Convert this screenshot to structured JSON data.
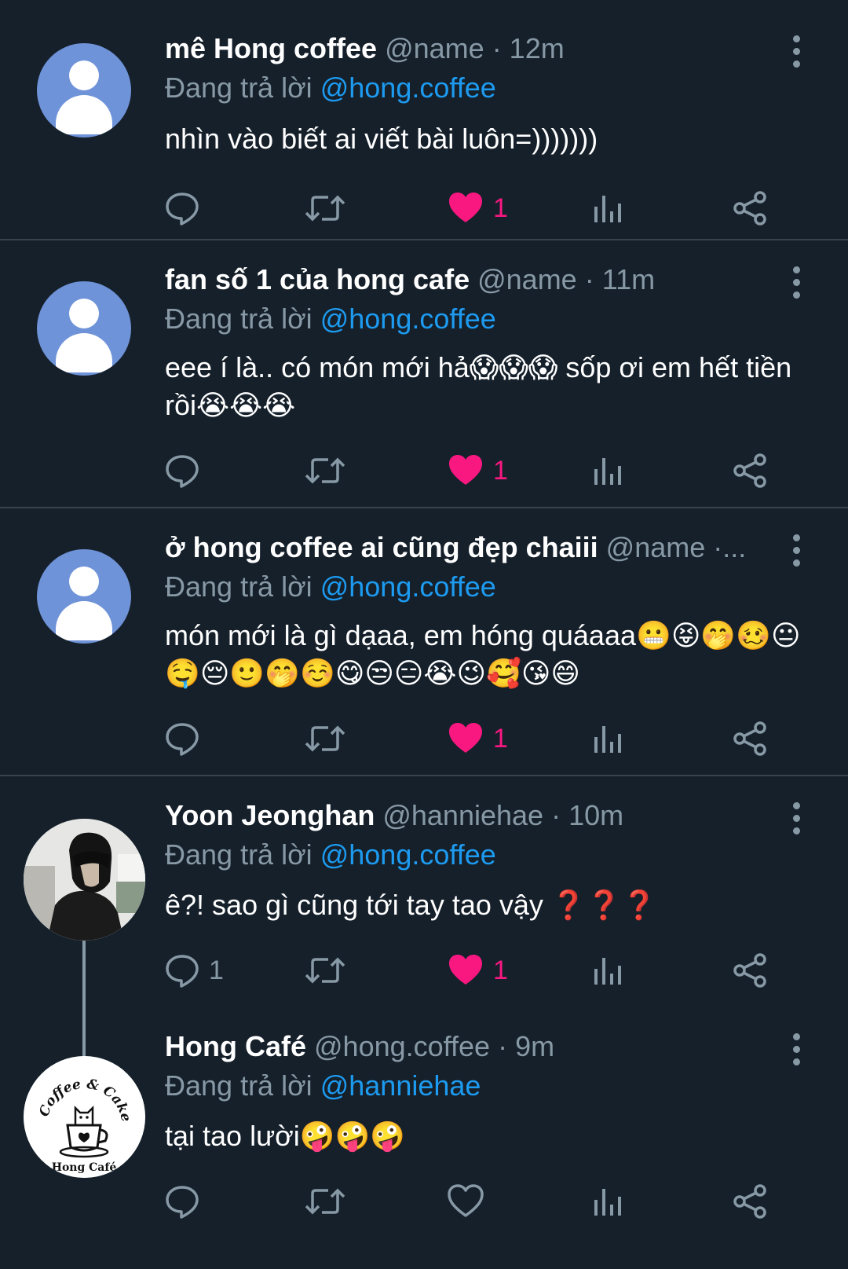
{
  "tweets": [
    {
      "name": "mê Hong coffee",
      "handle": "@name",
      "time": "· 12m",
      "reply_prefix": "Đang trả lời",
      "reply_to": "@hong.coffee",
      "text": "nhìn vào biết ai viết bài luôn=)))))))",
      "likes": "1",
      "replies": "",
      "liked": true
    },
    {
      "name": "fan số 1 của hong cafe",
      "handle": "@name",
      "time": "· 11m",
      "reply_prefix": "Đang trả lời",
      "reply_to": "@hong.coffee",
      "text": "eee í là.. có món mới hả😱😱😱 sốp ơi em hết tiền rồi😭😭😭",
      "likes": "1",
      "replies": "",
      "liked": true
    },
    {
      "name": "ở hong coffee ai cũng đẹp chaiii",
      "handle": "@name ·...",
      "time": "",
      "reply_prefix": "Đang trả lời",
      "reply_to": "@hong.coffee",
      "text": "món mới là gì dạaa, em hóng quáaaa😬😝🤭🥴😐🤤😔🙂🤭☺️😋😒😑😭😉🥰😘😄",
      "likes": "1",
      "replies": "",
      "liked": true
    },
    {
      "name": "Yoon Jeonghan",
      "handle": "@hanniehae",
      "time": "· 10m",
      "reply_prefix": "Đang trả lời",
      "reply_to": "@hong.coffee",
      "text": "ê?! sao gì cũng tới tay tao vậy ❓❓❓",
      "likes": "1",
      "replies": "1",
      "liked": true
    },
    {
      "name": "Hong Café",
      "handle": "@hong.coffee",
      "time": "· 9m",
      "reply_prefix": "Đang trả lời",
      "reply_to": "@hanniehae",
      "text": "tại tao lười🤪🤪🤪",
      "likes": "",
      "replies": "",
      "liked": false
    }
  ],
  "logo": {
    "top_text": "Coffee & Cake",
    "bottom_text": "Hong Café"
  },
  "colors": {
    "background": "#15202b",
    "muted": "#8899a6",
    "link": "#1d9bf0",
    "like": "#f91880",
    "divider": "#38444d"
  },
  "icons": [
    "reply-icon",
    "retweet-icon",
    "like-icon",
    "views-icon",
    "share-icon",
    "more-icon"
  ]
}
